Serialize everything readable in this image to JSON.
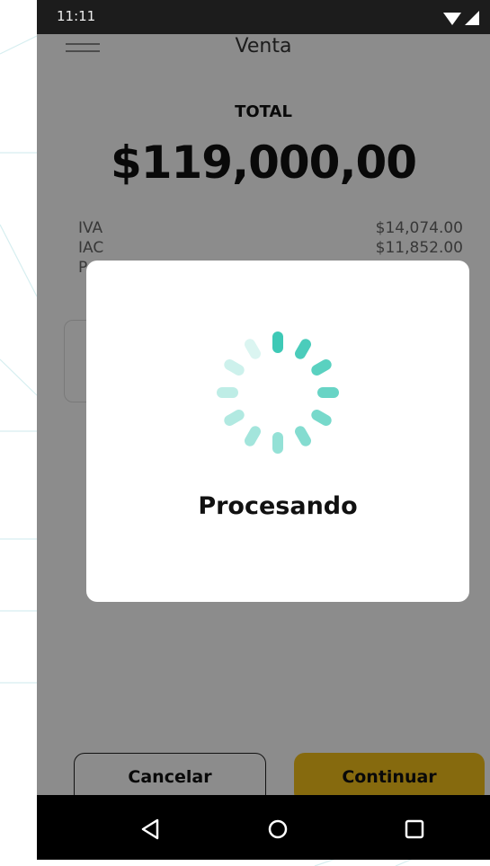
{
  "status_bar": {
    "time": "11:11"
  },
  "header": {
    "title": "Venta"
  },
  "summary": {
    "total_label": "TOTAL",
    "total_amount": "$119,000,00",
    "rows": [
      {
        "label": "IVA",
        "value": "$14,074.00"
      },
      {
        "label": "IAC",
        "value": "$11,852.00"
      },
      {
        "label": "P",
        "value": ""
      }
    ]
  },
  "actions": {
    "cancel_label": "Cancelar",
    "continue_label": "Continuar"
  },
  "modal": {
    "text": "Procesando"
  },
  "colors": {
    "accent": "#f4c21a",
    "spinner": "#3ec9b6",
    "status_bar": "#1c1c1c"
  }
}
